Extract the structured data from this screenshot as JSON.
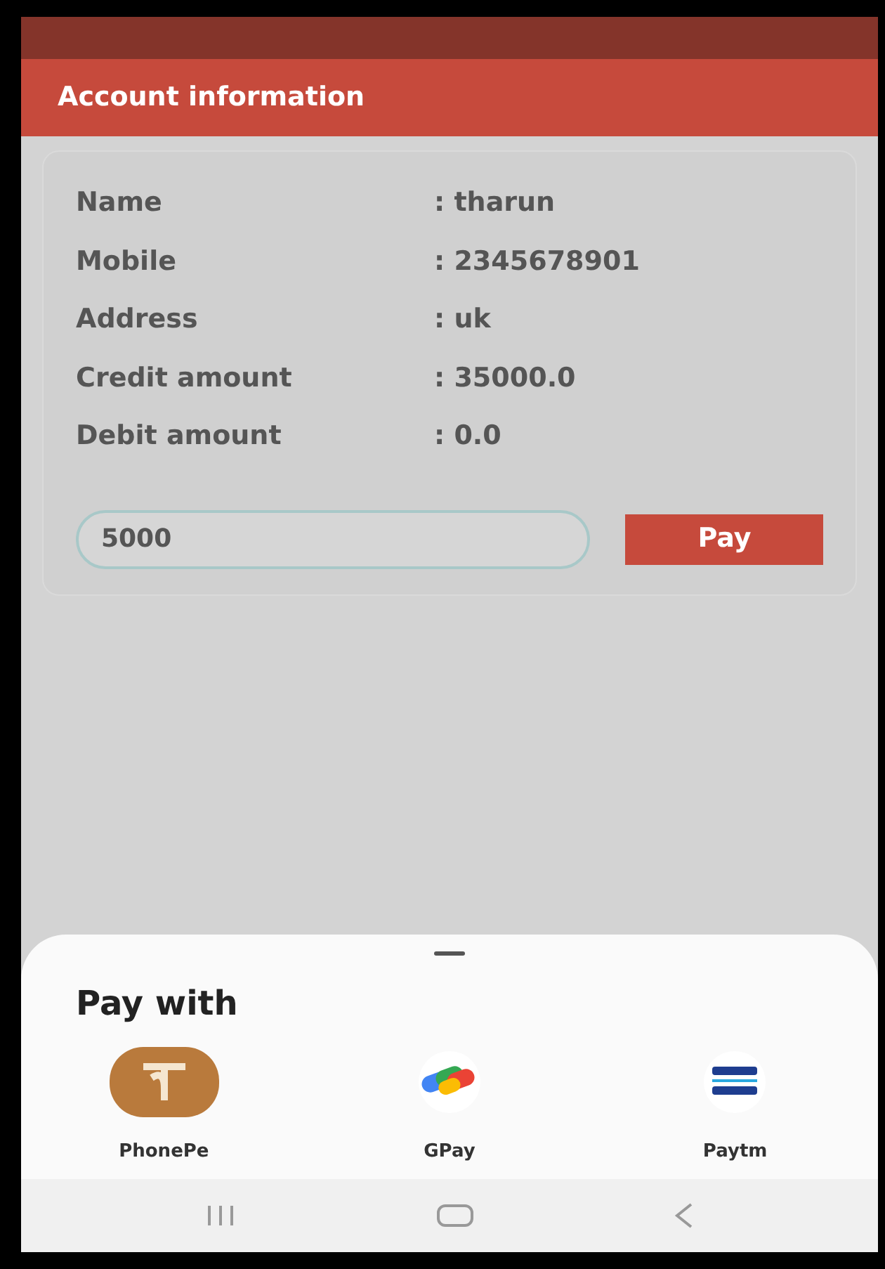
{
  "app_bar": {
    "title": "Account information"
  },
  "details": [
    {
      "label": "Name",
      "value": ": tharun"
    },
    {
      "label": "Mobile",
      "value": ": 2345678901"
    },
    {
      "label": "Address",
      "value": ": uk"
    },
    {
      "label": "Credit amount",
      "value": ": 35000.0"
    },
    {
      "label": "Debit amount",
      "value": ": 0.0"
    }
  ],
  "amount_field": {
    "value": "5000"
  },
  "pay_button": "Pay",
  "sheet": {
    "title": "Pay with",
    "apps": [
      {
        "kind": "phonepe",
        "label": "PhonePe"
      },
      {
        "kind": "gpay",
        "label": "GPay"
      },
      {
        "kind": "paytm",
        "label": "Paytm"
      }
    ]
  }
}
